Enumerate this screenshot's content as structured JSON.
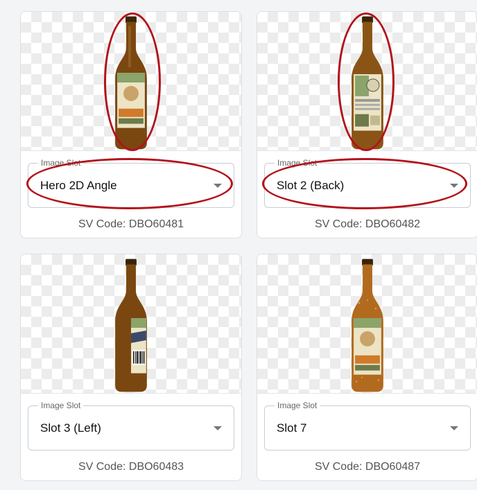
{
  "cards": [
    {
      "slot_legend": "Image Slot",
      "slot_value": "Hero 2D Angle",
      "sv_code": "SV Code: DBO60481",
      "bottle_view": "front label",
      "highlighted": true
    },
    {
      "slot_legend": "Image Slot",
      "slot_value": "Slot 2 (Back)",
      "sv_code": "SV Code: DBO60482",
      "bottle_view": "back label",
      "highlighted": true
    },
    {
      "slot_legend": "Image Slot",
      "slot_value": "Slot 3 (Left)",
      "sv_code": "SV Code: DBO60483",
      "bottle_view": "side barcode",
      "highlighted": false
    },
    {
      "slot_legend": "Image Slot",
      "slot_value": "Slot 7",
      "sv_code": "SV Code: DBO60487",
      "bottle_view": "front label condensation",
      "highlighted": false
    }
  ],
  "colors": {
    "annotation": "#b3121a",
    "bottle_glass": "#7a4710",
    "label_cream": "#ece4c4",
    "label_orange": "#d07a2a"
  },
  "icons": [
    "chevron-down-icon",
    "beer-bottle-image"
  ]
}
